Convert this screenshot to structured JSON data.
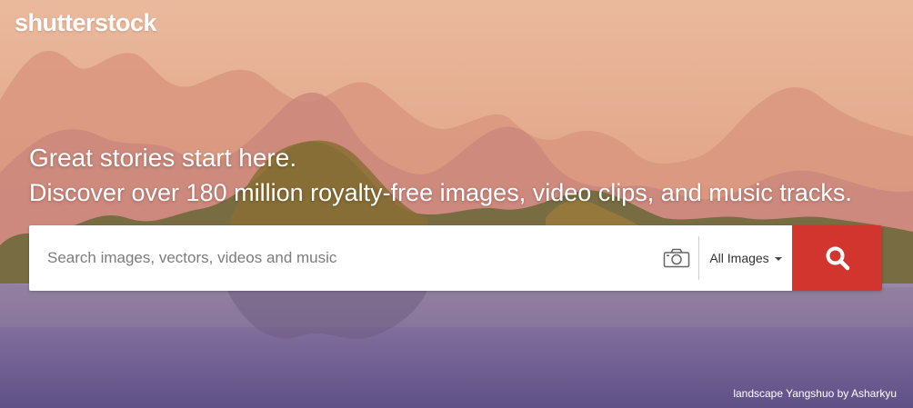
{
  "brand": {
    "logo_text": "shutterstock"
  },
  "hero": {
    "headline": "Great stories start here.",
    "subline": "Discover over 180 million royalty-free images, video clips, and music tracks."
  },
  "search": {
    "placeholder": "Search images, vectors, videos and music",
    "type_selected": "All Images",
    "camera_icon": "camera-icon",
    "submit_icon": "search-icon"
  },
  "photo_credit": "landscape Yangshuo by Asharkyu",
  "colors": {
    "search_button": "#d2352e",
    "text_on_image": "#ffffff"
  }
}
